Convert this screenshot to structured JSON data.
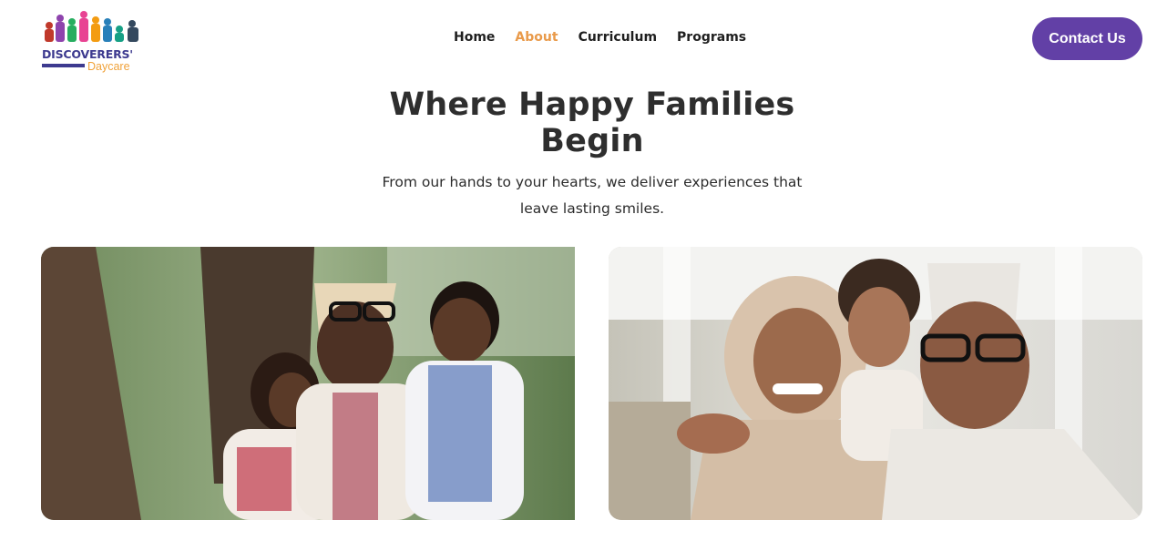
{
  "brand": {
    "name": "DISCOVERERS'",
    "sub": "Daycare"
  },
  "nav": {
    "items": [
      {
        "label": "Home",
        "active": false
      },
      {
        "label": "About",
        "active": true
      },
      {
        "label": "Curriculum",
        "active": false
      },
      {
        "label": "Programs",
        "active": false
      }
    ]
  },
  "header": {
    "contact_label": "Contact Us"
  },
  "hero": {
    "title_line1": "Where Happy Families",
    "title_line2": "Begin",
    "subtitle_line1": "From our hands to your hearts, we deliver experiences that",
    "subtitle_line2": "leave lasting smiles."
  },
  "colors": {
    "accent": "#6240a6",
    "active_nav": "#e99a4a",
    "brand_navy": "#3d3a8f",
    "brand_orange": "#f0a23a"
  }
}
